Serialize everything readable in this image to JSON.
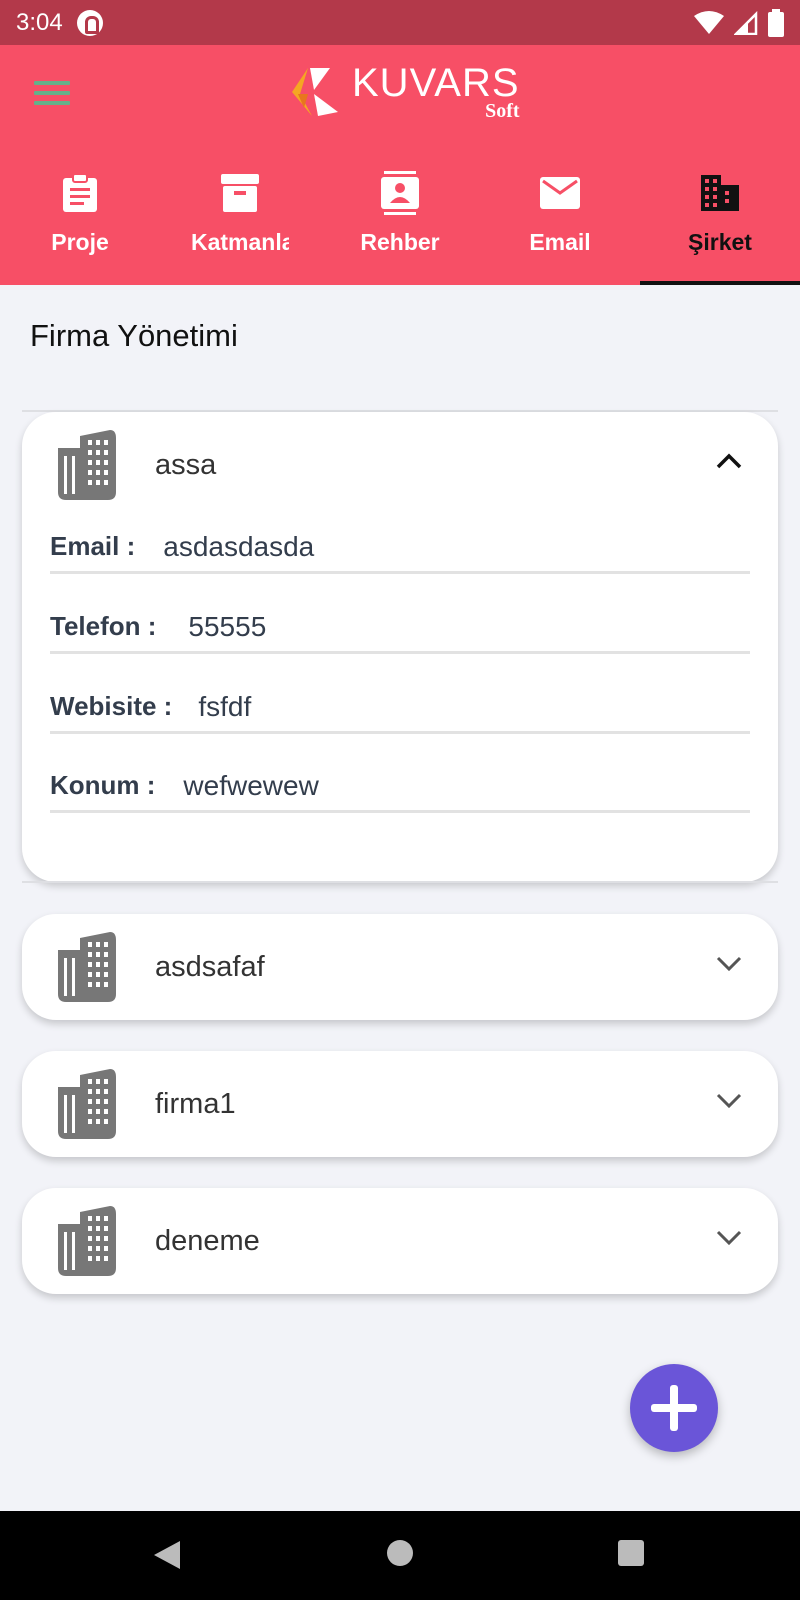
{
  "status_bar": {
    "time": "3:04"
  },
  "app_bar": {
    "logo": {
      "brand": "KUVARS",
      "sub": "Soft"
    }
  },
  "tabs": [
    {
      "label": "Proje",
      "icon": "clipboard-icon",
      "active": false
    },
    {
      "label": "Katmanlar",
      "icon": "archive-icon",
      "active": false
    },
    {
      "label": "Rehber",
      "icon": "contacts-icon",
      "active": false
    },
    {
      "label": "Email",
      "icon": "mail-icon",
      "active": false
    },
    {
      "label": "Şirket",
      "icon": "business-icon",
      "active": true
    }
  ],
  "page": {
    "title": "Firma Yönetimi"
  },
  "companies": [
    {
      "name": "assa",
      "expanded": true,
      "fields": [
        {
          "label": "Email :",
          "value": "asdasdasda"
        },
        {
          "label": "Telefon :",
          "value": "55555"
        },
        {
          "label": "Webisite :",
          "value": "fsfdf"
        },
        {
          "label": "Konum :",
          "value": "wefwewew"
        }
      ]
    },
    {
      "name": "asdsafaf",
      "expanded": false
    },
    {
      "name": "firma1",
      "expanded": false
    },
    {
      "name": "deneme",
      "expanded": false
    }
  ],
  "fab": {
    "icon": "plus-icon",
    "color": "#6a55d8"
  },
  "colors": {
    "appbar": "#f74f66",
    "statusbar": "#b3394a",
    "accent_menu": "#66b08a"
  }
}
